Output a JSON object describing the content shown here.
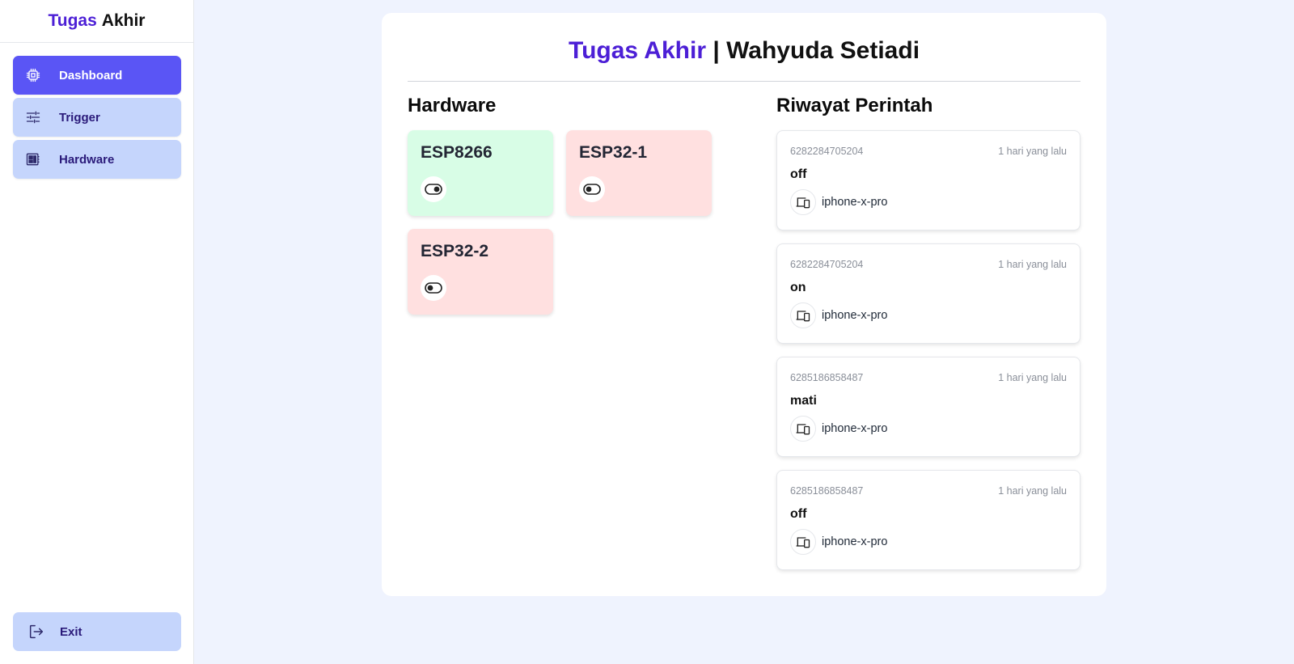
{
  "brand": {
    "accent": "Tugas",
    "rest": "Akhir"
  },
  "nav": [
    {
      "label": "Dashboard",
      "icon": "cpu-icon",
      "active": true
    },
    {
      "label": "Trigger",
      "icon": "sliders-icon",
      "active": false
    },
    {
      "label": "Hardware",
      "icon": "hardware-board-icon",
      "active": false
    }
  ],
  "exit": {
    "label": "Exit",
    "icon": "logout-icon"
  },
  "header": {
    "accent": "Tugas Akhir",
    "separator": "|",
    "name": "Wahyuda Setiadi"
  },
  "hardware": {
    "title": "Hardware",
    "devices": [
      {
        "name": "ESP8266",
        "status": "on",
        "color": "#d8fde6"
      },
      {
        "name": "ESP32-1",
        "status": "off",
        "color": "#ffe0e0"
      },
      {
        "name": "ESP32-2",
        "status": "off",
        "color": "#ffe0e0"
      }
    ]
  },
  "history": {
    "title": "Riwayat Perintah",
    "items": [
      {
        "number": "6282284705204",
        "time": "1 hari yang lalu",
        "command": "off",
        "device": "iphone-x-pro"
      },
      {
        "number": "6282284705204",
        "time": "1 hari yang lalu",
        "command": "on",
        "device": "iphone-x-pro"
      },
      {
        "number": "6285186858487",
        "time": "1 hari yang lalu",
        "command": "mati",
        "device": "iphone-x-pro"
      },
      {
        "number": "6285186858487",
        "time": "1 hari yang lalu",
        "command": "off",
        "device": "iphone-x-pro"
      }
    ]
  },
  "colors": {
    "accent": "#4c1fd6",
    "nav_active": "#5a55f5",
    "nav_idle": "#c5d5fc",
    "background": "#eff3fe"
  }
}
